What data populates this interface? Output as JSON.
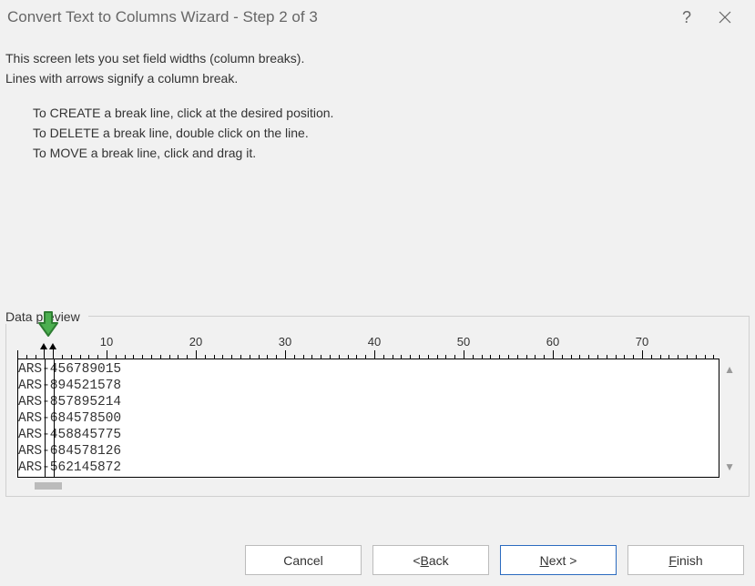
{
  "titlebar": {
    "title": "Convert Text to Columns Wizard - Step 2 of 3"
  },
  "intro": {
    "line1": "This screen lets you set field widths (column breaks).",
    "line2": "Lines with arrows signify a column break."
  },
  "instructions": {
    "create": "To CREATE a break line, click at the desired position.",
    "delete": "To DELETE a break line, double click on the line.",
    "move": "To MOVE a break line, click and drag it."
  },
  "preview": {
    "label": "Data preview",
    "ruler_labels": [
      "10",
      "20",
      "30",
      "40",
      "50",
      "60",
      "70"
    ],
    "break_positions": [
      3,
      4
    ],
    "rows": [
      "ARS-456789015",
      "ARS-894521578",
      "ARS-857895214",
      "ARS-684578500",
      "ARS-458845775",
      "ARS-684578126",
      "ARS-562145872"
    ]
  },
  "buttons": {
    "cancel": "Cancel",
    "back_prefix": "< ",
    "back_letter": "B",
    "back_rest": "ack",
    "next_letter": "N",
    "next_rest": "ext >",
    "finish_letter": "F",
    "finish_rest": "inish"
  }
}
